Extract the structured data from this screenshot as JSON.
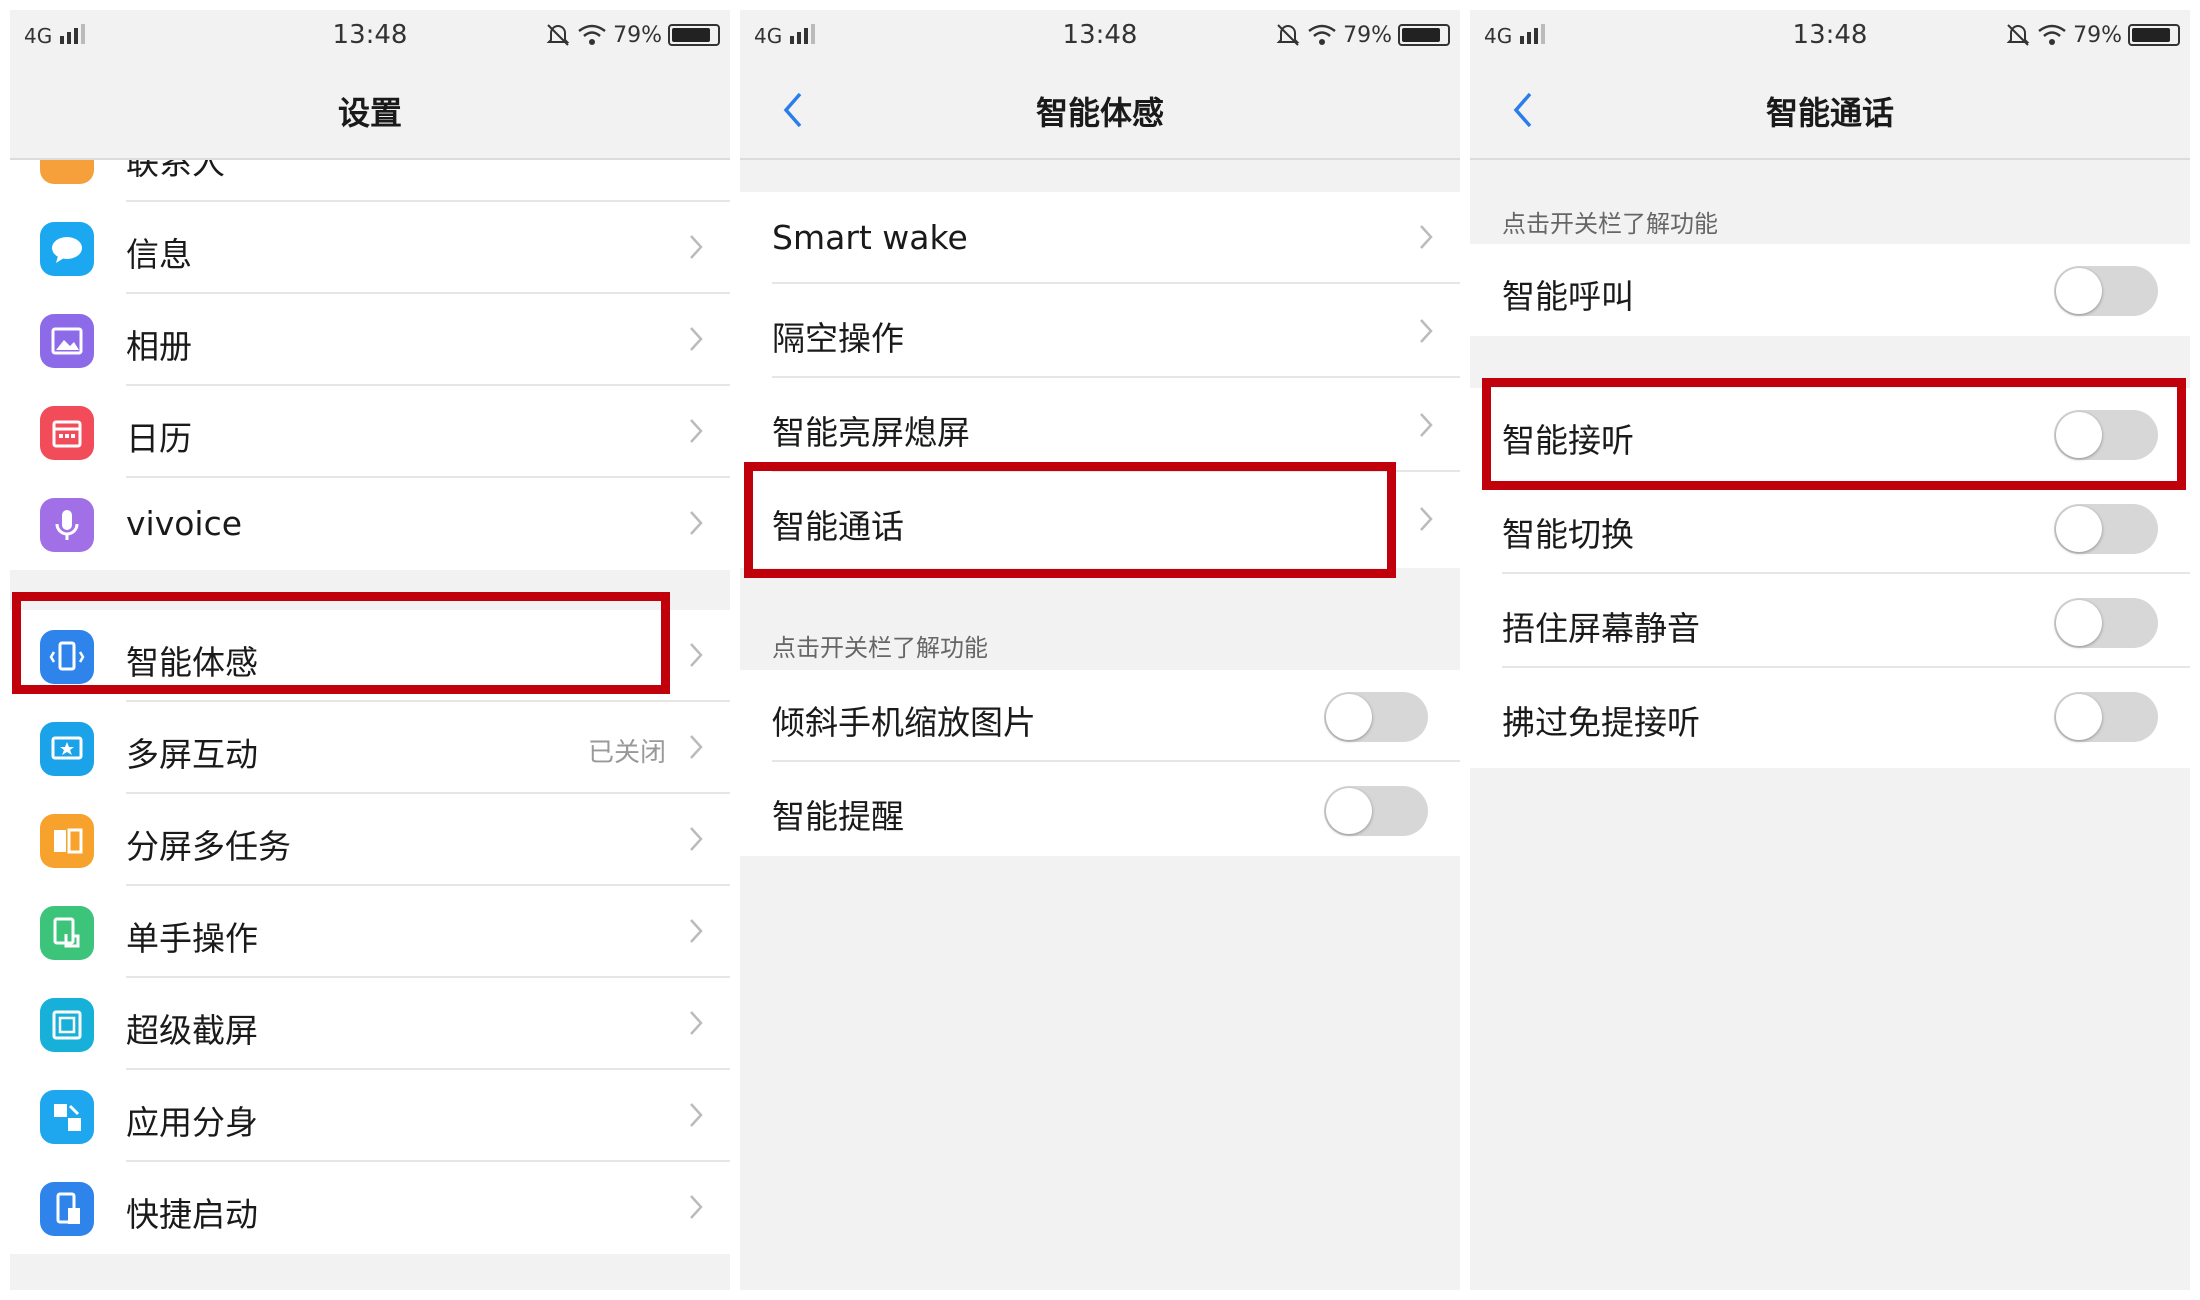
{
  "status": {
    "network": "4G",
    "time": "13:48",
    "battery": "79%"
  },
  "panel1": {
    "title": "设置",
    "partial_item": "联系人",
    "items_a": [
      {
        "label": "信息"
      },
      {
        "label": "相册"
      },
      {
        "label": "日历"
      },
      {
        "label": "vivoice"
      }
    ],
    "items_b": [
      {
        "label": "智能体感"
      },
      {
        "label": "多屏互动",
        "status": "已关闭"
      },
      {
        "label": "分屏多任务"
      },
      {
        "label": "单手操作"
      },
      {
        "label": "超级截屏"
      },
      {
        "label": "应用分身"
      },
      {
        "label": "快捷启动"
      }
    ]
  },
  "panel2": {
    "title": "智能体感",
    "nav_items": [
      {
        "label": "Smart wake"
      },
      {
        "label": "隔空操作"
      },
      {
        "label": "智能亮屏熄屏"
      },
      {
        "label": "智能通话"
      }
    ],
    "hint": "点击开关栏了解功能",
    "toggles": [
      {
        "label": "倾斜手机缩放图片",
        "on": false
      },
      {
        "label": "智能提醒",
        "on": false
      }
    ]
  },
  "panel3": {
    "title": "智能通话",
    "hint": "点击开关栏了解功能",
    "toggle_a": {
      "label": "智能呼叫",
      "on": false
    },
    "toggles_b": [
      {
        "label": "智能接听",
        "on": false
      },
      {
        "label": "智能切换",
        "on": false
      },
      {
        "label": "捂住屏幕静音",
        "on": false
      },
      {
        "label": "拂过免提接听",
        "on": false
      }
    ]
  },
  "colors": {
    "highlight": "#c0000a",
    "accent": "#2b7de9",
    "toggle_off": "#d7d7d7"
  }
}
